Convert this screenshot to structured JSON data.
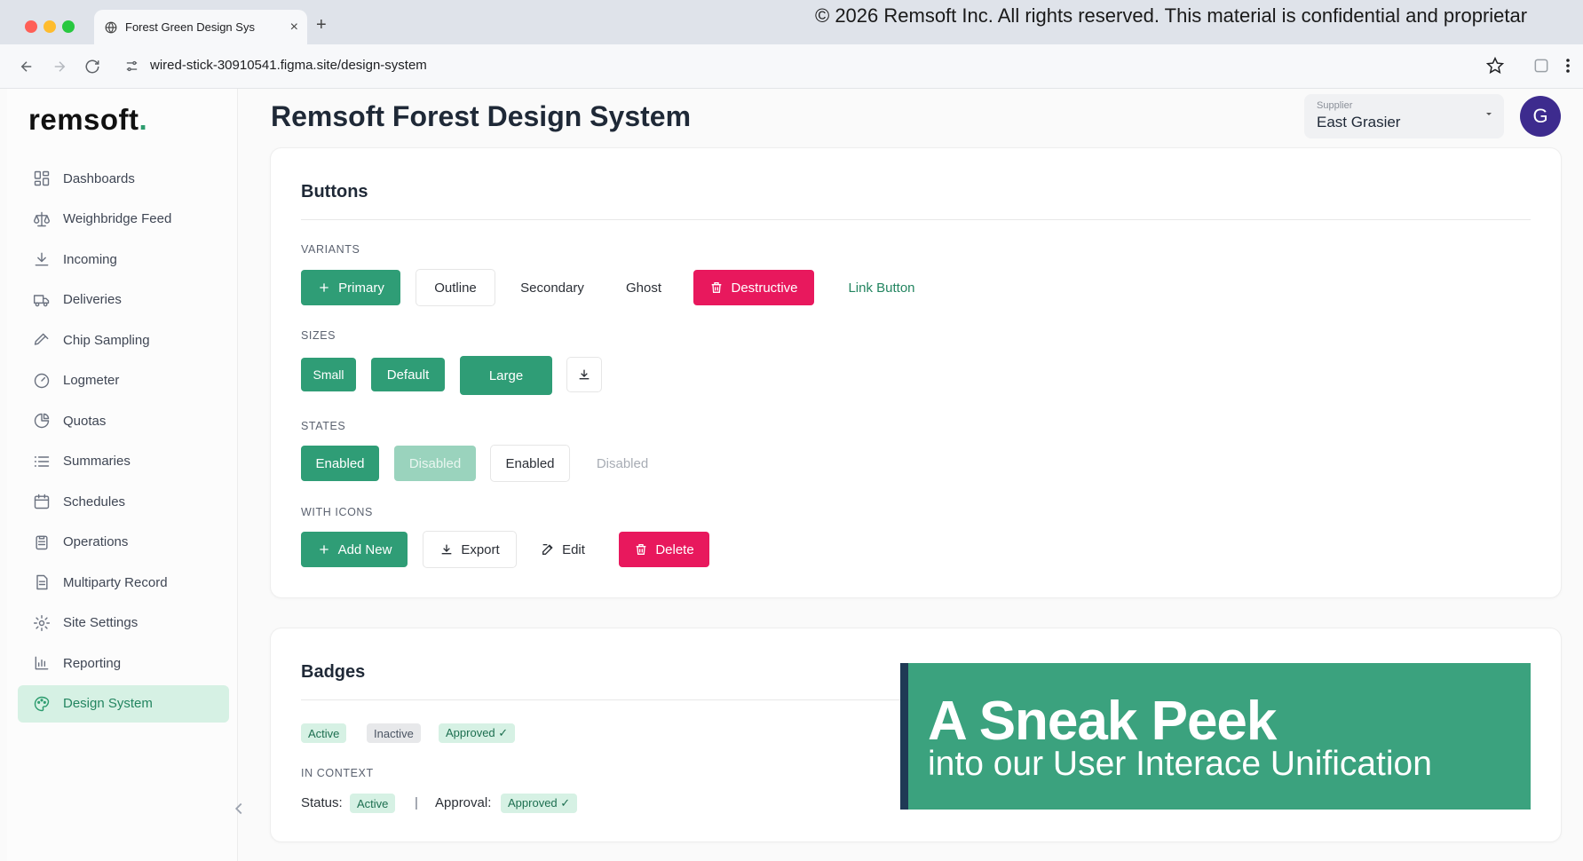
{
  "browser": {
    "tab_title": "Forest Green Design Sys",
    "tab_close": "×",
    "new_tab": "+",
    "url": "wired-stick-30910541.figma.site/design-system",
    "copyright": "© 2026 Remsoft Inc. All rights reserved. This material is confidential and proprietar"
  },
  "sidebar": {
    "logo_text": "remsoft",
    "logo_dot": ".",
    "items": [
      {
        "label": "Dashboards",
        "icon": "dashboard-icon"
      },
      {
        "label": "Weighbridge Feed",
        "icon": "scale-icon"
      },
      {
        "label": "Incoming",
        "icon": "download-icon"
      },
      {
        "label": "Deliveries",
        "icon": "truck-icon"
      },
      {
        "label": "Chip Sampling",
        "icon": "pipette-icon"
      },
      {
        "label": "Logmeter",
        "icon": "gauge-icon"
      },
      {
        "label": "Quotas",
        "icon": "pie-chart-icon"
      },
      {
        "label": "Summaries",
        "icon": "list-icon"
      },
      {
        "label": "Schedules",
        "icon": "calendar-icon"
      },
      {
        "label": "Operations",
        "icon": "clipboard-icon"
      },
      {
        "label": "Multiparty Record",
        "icon": "file-icon"
      },
      {
        "label": "Site Settings",
        "icon": "gear-icon"
      },
      {
        "label": "Reporting",
        "icon": "bar-chart-icon"
      },
      {
        "label": "Design System",
        "icon": "palette-icon",
        "active": true
      }
    ]
  },
  "header": {
    "title": "Remsoft Forest Design System",
    "supplier_label": "Supplier",
    "supplier_value": "East Grasier",
    "avatar_initial": "G"
  },
  "buttons_card": {
    "title": "Buttons",
    "variants_label": "VARIANTS",
    "variants": {
      "primary": "Primary",
      "outline": "Outline",
      "secondary": "Secondary",
      "ghost": "Ghost",
      "destructive": "Destructive",
      "link": "Link Button"
    },
    "sizes_label": "SIZES",
    "sizes": {
      "small": "Small",
      "default": "Default",
      "large": "Large"
    },
    "states_label": "STATES",
    "states": {
      "enabled": "Enabled",
      "disabled": "Disabled",
      "outline_enabled": "Enabled",
      "outline_disabled": "Disabled"
    },
    "icons_label": "WITH ICONS",
    "icons": {
      "add_new": "Add New",
      "export": "Export",
      "edit": "Edit",
      "delete": "Delete"
    }
  },
  "badges_card": {
    "title": "Badges",
    "badges": {
      "active": "Active",
      "inactive": "Inactive",
      "approved": "Approved ✓"
    },
    "context_label": "IN CONTEXT",
    "context": {
      "status_label": "Status:",
      "status_value": "Active",
      "separator": "|",
      "approval_label": "Approval:",
      "approval_value": "Approved ✓"
    }
  },
  "banner": {
    "headline": "A Sneak Peek",
    "subline": "into our User Interace Unification"
  },
  "colors": {
    "primary": "#2f9d76",
    "destructive": "#e8185d",
    "active_nav_bg": "#d6f1e4",
    "banner_bg": "#3ba27e",
    "avatar_bg": "#3d2b8e"
  }
}
